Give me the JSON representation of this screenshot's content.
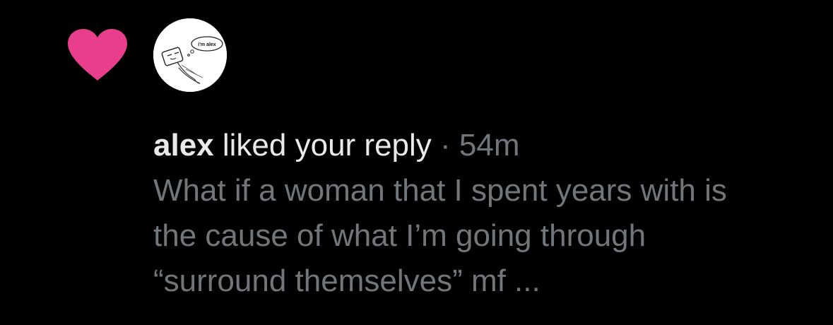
{
  "notification": {
    "icon": "heart-icon",
    "icon_color": "#f91880",
    "avatar_bubble_text": "i'm alex",
    "username": "alex",
    "action_text": "liked your reply",
    "separator": "·",
    "timestamp": "54m",
    "reply_text": "What if a woman that I spent years with is the cause of what I’m going through “surround themselves” mf ..."
  },
  "colors": {
    "background": "#000000",
    "primary_text": "#e7e9ea",
    "secondary_text": "#71767b",
    "like_pink": "#f91880"
  }
}
